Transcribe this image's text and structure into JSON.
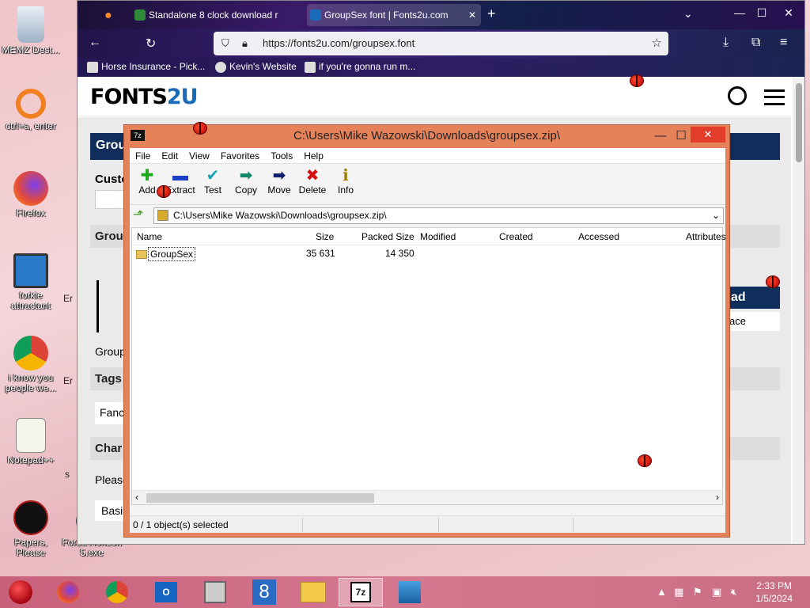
{
  "desktop": {
    "icons": [
      {
        "label": "MEMZ Dest...",
        "icon": "recycle-bin-icon"
      },
      {
        "label": "ctrl+a, enter",
        "icon": "ring-icon"
      },
      {
        "label": "Firefox",
        "icon": "firefox-icon"
      },
      {
        "label": "forkie attractant",
        "icon": "monitor-gear-icon"
      },
      {
        "label": "i know you people we...",
        "icon": "chrome-icon"
      },
      {
        "label": "Notepad++",
        "icon": "notepad-icon"
      },
      {
        "label": "Papers, Please",
        "icon": "papers-please-icon"
      },
      {
        "label": "Forza Horizon 5.exe",
        "icon": "app-icon"
      }
    ]
  },
  "browser": {
    "tabs": [
      {
        "label": "Standalone 8 clock download r",
        "icon": "page-icon"
      },
      {
        "label": "GroupSex font | Fonts2u.com",
        "icon": "fonts2u-icon",
        "close": "✕"
      }
    ],
    "new_tab": "+",
    "url": "https://fonts2u.com/groupsex.font",
    "bookmarks": [
      "Horse Insurance - Pick...",
      "Kevin's Website",
      "if you're gonna run m..."
    ],
    "win_controls": {
      "minimize": "—",
      "maximize": "☐",
      "close": "✕"
    }
  },
  "site": {
    "logo_main": "FONTS",
    "logo_accent": "2U",
    "fragments": [
      "Grou",
      "Custo",
      "Grou",
      "Group",
      "Tags",
      "Fanc",
      "Char",
      "Please",
      "Basi",
      "ad",
      "ace",
      "Er",
      "Er",
      "s"
    ]
  },
  "zip": {
    "title": "C:\\Users\\Mike Wazowski\\Downloads\\groupsex.zip\\",
    "menu": [
      "File",
      "Edit",
      "View",
      "Favorites",
      "Tools",
      "Help"
    ],
    "toolbar": [
      {
        "label": "Add",
        "icon": "add-icon",
        "color": "#1da81d",
        "glyph": "✚"
      },
      {
        "label": "Extract",
        "icon": "extract-icon",
        "color": "#1c3fc8",
        "glyph": "▬"
      },
      {
        "label": "Test",
        "icon": "test-icon",
        "color": "#19a6b8",
        "glyph": "✔"
      },
      {
        "label": "Copy",
        "icon": "copy-icon",
        "color": "#128a6a",
        "glyph": "➡"
      },
      {
        "label": "Move",
        "icon": "move-icon",
        "color": "#10206e",
        "glyph": "➡"
      },
      {
        "label": "Delete",
        "icon": "delete-icon",
        "color": "#d41010",
        "glyph": "✖"
      },
      {
        "label": "Info",
        "icon": "info-icon",
        "color": "#a08000",
        "glyph": "ℹ"
      }
    ],
    "address": "C:\\Users\\Mike Wazowski\\Downloads\\groupsex.zip\\",
    "columns": [
      "Name",
      "Size",
      "Packed Size",
      "Modified",
      "Created",
      "Accessed",
      "Attributes"
    ],
    "rows": [
      {
        "name": "GroupSex",
        "size": "35 631",
        "packed": "14 350"
      }
    ],
    "status": "0 / 1 object(s) selected"
  },
  "taskbar": {
    "clock_time": "2:33 PM",
    "clock_date": "1/5/2024",
    "apps": [
      "start-orb-icon",
      "firefox-icon",
      "chrome-icon",
      "outlook-icon",
      "app-icon",
      "8-icon",
      "file-explorer-icon",
      "7zip-icon",
      "control-panel-icon"
    ]
  },
  "colors": {
    "zip_frame": "#e6825a",
    "site_bar": "#0f2e5b",
    "taskbar": "#c8607a"
  }
}
